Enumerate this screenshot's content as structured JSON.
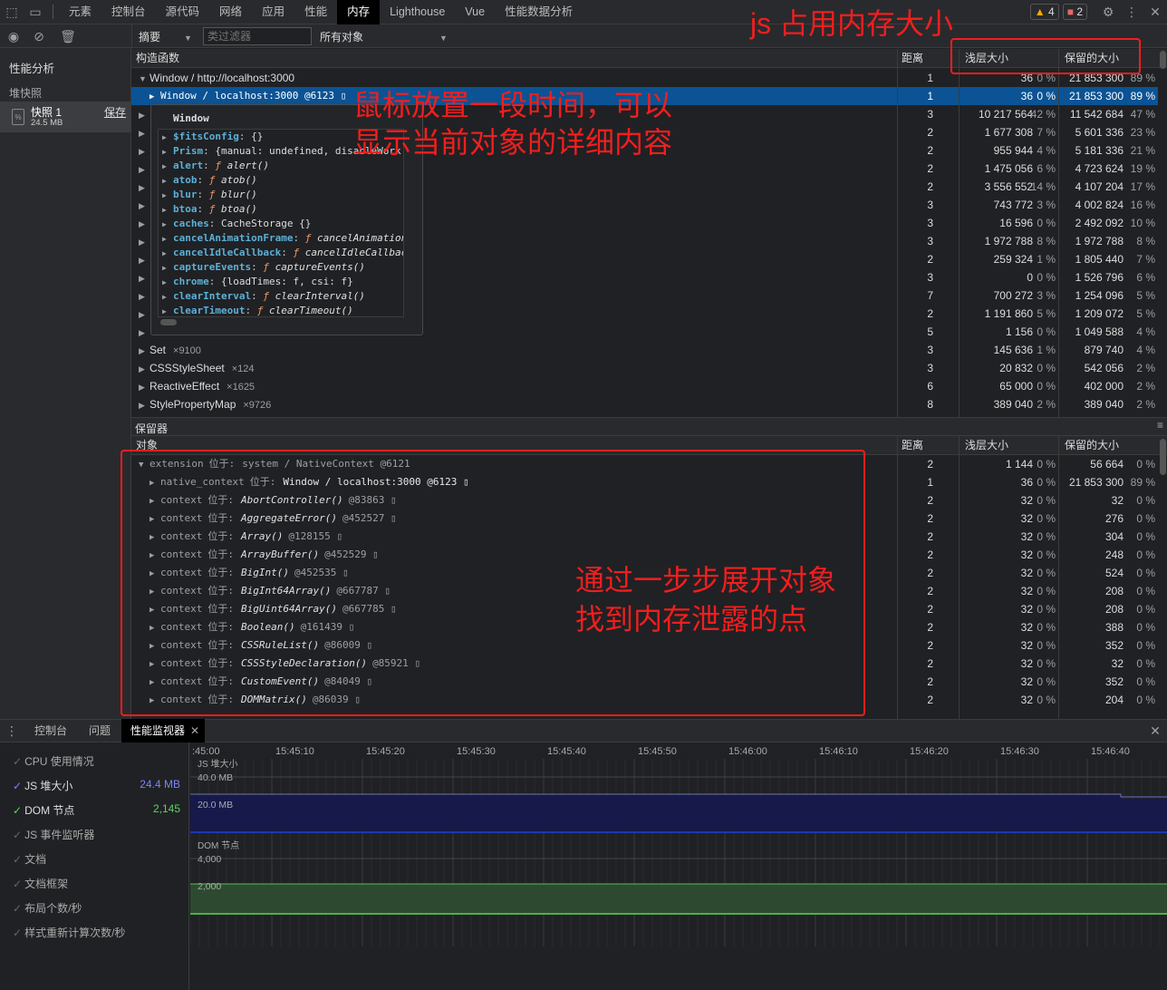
{
  "tabs": [
    "元素",
    "控制台",
    "源代码",
    "网络",
    "应用",
    "性能",
    "内存",
    "Lighthouse",
    "Vue",
    "性能数据分析"
  ],
  "active_tab": "内存",
  "badges": {
    "warnings": "4",
    "errors": "2"
  },
  "toolbar": {
    "view": "摘要",
    "class_filter_placeholder": "类过滤器",
    "objects": "所有对象"
  },
  "sidebar": {
    "title": "性能分析",
    "section": "堆快照",
    "snapshot": {
      "name": "快照 1",
      "size": "24.5 MB",
      "save": "保存"
    }
  },
  "columns": {
    "constructor": "构造函数",
    "distance": "距离",
    "shallow": "浅层大小",
    "retained": "保留的大小"
  },
  "heap_rows": [
    {
      "name": "Window / http://localhost:3000",
      "count": "",
      "d": "1",
      "s": "36",
      "sp": "0 %",
      "r": "21 853 300",
      "rp": "89 %",
      "open": true,
      "indent": 0
    },
    {
      "name": "Window / localhost:3000 @6123 ▯",
      "count": "",
      "d": "1",
      "s": "36",
      "sp": "0 %",
      "r": "21 853 300",
      "rp": "89 %",
      "sel": true,
      "indent": 1
    },
    {
      "name": "",
      "d": "3",
      "s": "10 217 564",
      "sp": "42 %",
      "r": "11 542 684",
      "rp": "47 %"
    },
    {
      "name": "",
      "d": "2",
      "s": "1 677 308",
      "sp": "7 %",
      "r": "5 601 336",
      "rp": "23 %"
    },
    {
      "name": "",
      "d": "2",
      "s": "955 944",
      "sp": "4 %",
      "r": "5 181 336",
      "rp": "21 %"
    },
    {
      "name": "",
      "d": "2",
      "s": "1 475 056",
      "sp": "6 %",
      "r": "4 723 624",
      "rp": "19 %"
    },
    {
      "name": "",
      "d": "2",
      "s": "3 556 552",
      "sp": "14 %",
      "r": "4 107 204",
      "rp": "17 %"
    },
    {
      "name": "",
      "d": "3",
      "s": "743 772",
      "sp": "3 %",
      "r": "4 002 824",
      "rp": "16 %"
    },
    {
      "name": "",
      "d": "3",
      "s": "16 596",
      "sp": "0 %",
      "r": "2 492 092",
      "rp": "10 %"
    },
    {
      "name": "",
      "d": "3",
      "s": "1 972 788",
      "sp": "8 %",
      "r": "1 972 788",
      "rp": "8 %"
    },
    {
      "name": "",
      "d": "2",
      "s": "259 324",
      "sp": "1 %",
      "r": "1 805 440",
      "rp": "7 %"
    },
    {
      "name": "",
      "d": "3",
      "s": "0",
      "sp": "0 %",
      "r": "1 526 796",
      "rp": "6 %"
    },
    {
      "name": "",
      "d": "7",
      "s": "700 272",
      "sp": "3 %",
      "r": "1 254 096",
      "rp": "5 %"
    },
    {
      "name": "",
      "d": "2",
      "s": "1 191 860",
      "sp": "5 %",
      "r": "1 209 072",
      "rp": "5 %"
    },
    {
      "name": "",
      "d": "5",
      "s": "1 156",
      "sp": "0 %",
      "r": "1 049 588",
      "rp": "4 %"
    },
    {
      "name": "Set",
      "count": "×9100",
      "d": "3",
      "s": "145 636",
      "sp": "1 %",
      "r": "879 740",
      "rp": "4 %"
    },
    {
      "name": "CSSStyleSheet",
      "count": "×124",
      "d": "3",
      "s": "20 832",
      "sp": "0 %",
      "r": "542 056",
      "rp": "2 %"
    },
    {
      "name": "ReactiveEffect",
      "count": "×1625",
      "d": "6",
      "s": "65 000",
      "sp": "0 %",
      "r": "402 000",
      "rp": "2 %"
    },
    {
      "name": "StylePropertyMap",
      "count": "×9726",
      "d": "8",
      "s": "389 040",
      "sp": "2 %",
      "r": "389 040",
      "rp": "2 %"
    }
  ],
  "tooltip": {
    "title": "Window",
    "lines": [
      {
        "k": "$fitsConfig",
        "v": "{}"
      },
      {
        "k": "Prism",
        "v": "{manual: undefined, disableWork"
      },
      {
        "k": "alert",
        "fn": "alert()"
      },
      {
        "k": "atob",
        "fn": "atob()"
      },
      {
        "k": "blur",
        "fn": "blur()"
      },
      {
        "k": "btoa",
        "fn": "btoa()"
      },
      {
        "k": "caches",
        "v": "CacheStorage {}"
      },
      {
        "k": "cancelAnimationFrame",
        "fn": "cancelAnimation"
      },
      {
        "k": "cancelIdleCallback",
        "fn": "cancelIdleCallbac"
      },
      {
        "k": "captureEvents",
        "fn": "captureEvents()"
      },
      {
        "k": "chrome",
        "v": "{loadTimes: f, csi: f}"
      },
      {
        "k": "clearInterval",
        "fn": "clearInterval()"
      },
      {
        "k": "clearTimeout",
        "fn": "clearTimeout()"
      }
    ]
  },
  "retainers": {
    "title": "保留器",
    "object_col": "对象",
    "rows": [
      {
        "edge": "extension",
        "at": "位于:",
        "target": "system / NativeContext @6121",
        "open": true,
        "d": "2",
        "s": "1 144",
        "sp": "0 %",
        "r": "56 664",
        "rp": "0 %"
      },
      {
        "edge": "native_context",
        "at": "位于:",
        "target": "Window / localhost:3000 @6123 ▯",
        "d": "1",
        "s": "36",
        "sp": "0 %",
        "r": "21 853 300",
        "rp": "89 %",
        "plain": true
      },
      {
        "edge": "context",
        "at": "位于:",
        "target": "AbortController()",
        "id": "@83863 ▯",
        "d": "2",
        "s": "32",
        "sp": "0 %",
        "r": "32",
        "rp": "0 %"
      },
      {
        "edge": "context",
        "at": "位于:",
        "target": "AggregateError()",
        "id": "@452527 ▯",
        "d": "2",
        "s": "32",
        "sp": "0 %",
        "r": "276",
        "rp": "0 %"
      },
      {
        "edge": "context",
        "at": "位于:",
        "target": "Array()",
        "id": "@128155 ▯",
        "d": "2",
        "s": "32",
        "sp": "0 %",
        "r": "304",
        "rp": "0 %"
      },
      {
        "edge": "context",
        "at": "位于:",
        "target": "ArrayBuffer()",
        "id": "@452529 ▯",
        "d": "2",
        "s": "32",
        "sp": "0 %",
        "r": "248",
        "rp": "0 %"
      },
      {
        "edge": "context",
        "at": "位于:",
        "target": "BigInt()",
        "id": "@452535 ▯",
        "d": "2",
        "s": "32",
        "sp": "0 %",
        "r": "524",
        "rp": "0 %"
      },
      {
        "edge": "context",
        "at": "位于:",
        "target": "BigInt64Array()",
        "id": "@667787 ▯",
        "d": "2",
        "s": "32",
        "sp": "0 %",
        "r": "208",
        "rp": "0 %"
      },
      {
        "edge": "context",
        "at": "位于:",
        "target": "BigUint64Array()",
        "id": "@667785 ▯",
        "d": "2",
        "s": "32",
        "sp": "0 %",
        "r": "208",
        "rp": "0 %"
      },
      {
        "edge": "context",
        "at": "位于:",
        "target": "Boolean()",
        "id": "@161439 ▯",
        "d": "2",
        "s": "32",
        "sp": "0 %",
        "r": "388",
        "rp": "0 %"
      },
      {
        "edge": "context",
        "at": "位于:",
        "target": "CSSRuleList()",
        "id": "@86009 ▯",
        "d": "2",
        "s": "32",
        "sp": "0 %",
        "r": "352",
        "rp": "0 %"
      },
      {
        "edge": "context",
        "at": "位于:",
        "target": "CSSStyleDeclaration()",
        "id": "@85921 ▯",
        "d": "2",
        "s": "32",
        "sp": "0 %",
        "r": "32",
        "rp": "0 %"
      },
      {
        "edge": "context",
        "at": "位于:",
        "target": "CustomEvent()",
        "id": "@84049 ▯",
        "d": "2",
        "s": "32",
        "sp": "0 %",
        "r": "352",
        "rp": "0 %"
      },
      {
        "edge": "context",
        "at": "位于:",
        "target": "DOMMatrix()",
        "id": "@86039 ▯",
        "d": "2",
        "s": "32",
        "sp": "0 %",
        "r": "204",
        "rp": "0 %"
      }
    ]
  },
  "drawer": {
    "tabs": [
      "控制台",
      "问题",
      "性能监视器"
    ],
    "active": "性能监视器"
  },
  "monitor": {
    "metrics": [
      {
        "label": "CPU 使用情况",
        "value": "",
        "on": false
      },
      {
        "label": "JS 堆大小",
        "value": "24.4 MB",
        "on": true,
        "color": "#7c83fd"
      },
      {
        "label": "DOM 节点",
        "value": "2,145",
        "on": true,
        "color": "#5cd65c"
      },
      {
        "label": "JS 事件监听器",
        "value": "",
        "on": false
      },
      {
        "label": "文档",
        "value": "",
        "on": false
      },
      {
        "label": "文档框架",
        "value": "",
        "on": false
      },
      {
        "label": "布局个数/秒",
        "value": "",
        "on": false
      },
      {
        "label": "样式重新计算次数/秒",
        "value": "",
        "on": false
      }
    ],
    "times": [
      ":45:00",
      "15:45:10",
      "15:45:20",
      "15:45:30",
      "15:45:40",
      "15:45:50",
      "15:46:00",
      "15:46:10",
      "15:46:20",
      "15:46:30",
      "15:46:40"
    ],
    "heap_chart": {
      "label": "JS 堆大小",
      "ticks": [
        "40.0 MB",
        "20.0 MB"
      ]
    },
    "dom_chart": {
      "label": "DOM 节点",
      "ticks": [
        "4,000",
        "2,000"
      ]
    }
  },
  "annotations": {
    "size": "js 占用内存大小",
    "hover1": "鼠标放置一段时间，可以",
    "hover2": "显示当前对象的详细内容",
    "expand1": "通过一步步展开对象",
    "expand2": "找到内存泄露的点"
  }
}
